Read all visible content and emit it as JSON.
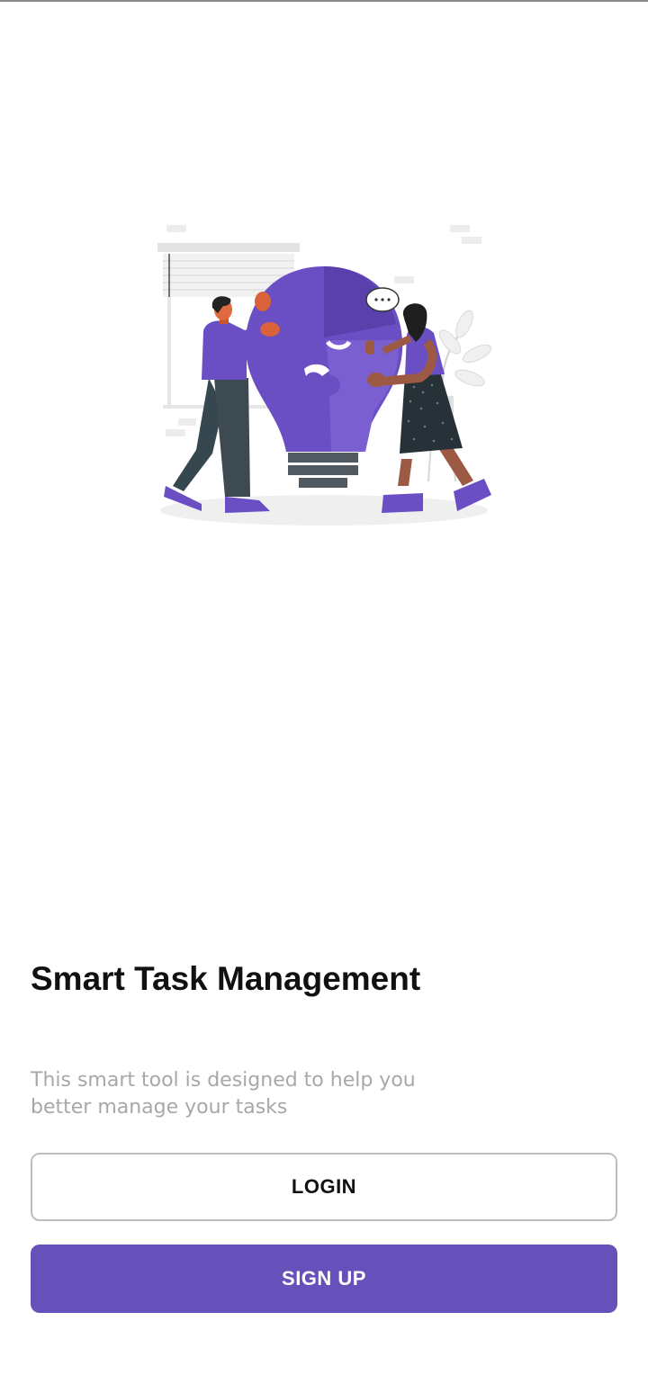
{
  "app": {
    "title": "Smart Task Management",
    "subtitle": "This smart tool is designed to help you better manage your tasks"
  },
  "actions": {
    "login_label": "LOGIN",
    "signup_label": "SIGN UP"
  },
  "illustration": {
    "name": "teamwork-puzzle-lightbulb-illustration",
    "speech_bubble_text": "..."
  },
  "colors": {
    "accent": "#6650b9",
    "illustration_purple": "#6a4fc4",
    "illustration_purple_dark": "#5a40ad",
    "text_primary": "#111111",
    "text_secondary": "#a8a8a8",
    "button_border": "#bdbdbd",
    "background": "#ffffff"
  }
}
